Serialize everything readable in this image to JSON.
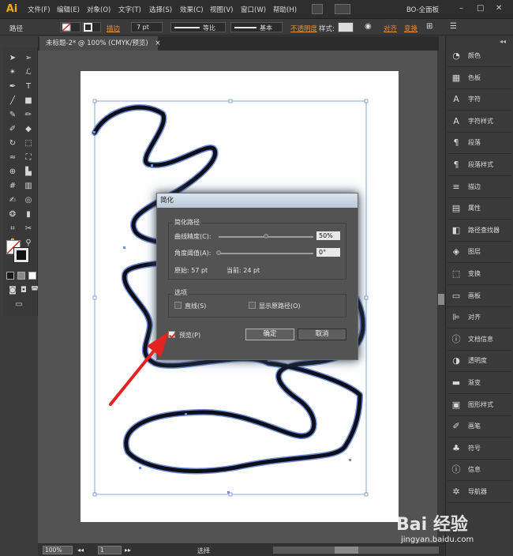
{
  "app": {
    "logo": "Ai",
    "menus": [
      "文件(F)",
      "编辑(E)",
      "对象(O)",
      "文字(T)",
      "选择(S)",
      "效果(C)",
      "视图(V)",
      "窗口(W)",
      "帮助(H)"
    ],
    "workspace": "BO-全面板",
    "window_controls": [
      "–",
      "□",
      "✕"
    ]
  },
  "control_bar": {
    "selection": "路径",
    "stroke_label": "描边",
    "stroke_weight": "7 pt",
    "profile_label": "等比",
    "brush_label": "基本",
    "opacity_label": "不透明度",
    "style_label": "样式:",
    "align_label": "对齐",
    "transform_label": "变换"
  },
  "document": {
    "tab_title": "未标题-2* @ 100% (CMYK/预览)",
    "tab_close": "×"
  },
  "status_bar": {
    "zoom": "100%",
    "page": "1",
    "tool": "选择"
  },
  "right_panel": {
    "items": [
      {
        "icon": "color-icon",
        "glyph": "◔",
        "label": "颜色"
      },
      {
        "icon": "swatches-icon",
        "glyph": "▦",
        "label": "色板"
      },
      {
        "icon": "character-icon",
        "glyph": "A",
        "label": "字符"
      },
      {
        "icon": "char-style-icon",
        "glyph": "A",
        "label": "字符样式"
      },
      {
        "icon": "paragraph-icon",
        "glyph": "¶",
        "label": "段落"
      },
      {
        "icon": "para-style-icon",
        "glyph": "¶",
        "label": "段落样式"
      },
      {
        "icon": "stroke-icon",
        "glyph": "≡",
        "label": "描边"
      },
      {
        "icon": "attributes-icon",
        "glyph": "▤",
        "label": "属性"
      },
      {
        "icon": "pathfinder-icon",
        "glyph": "◧",
        "label": "路径查找器"
      },
      {
        "icon": "layers-icon",
        "glyph": "◈",
        "label": "图层"
      },
      {
        "icon": "transform-icon",
        "glyph": "⬚",
        "label": "变换"
      },
      {
        "icon": "artboards-icon",
        "glyph": "▭",
        "label": "画板"
      },
      {
        "icon": "align-icon",
        "glyph": "⊫",
        "label": "对齐"
      },
      {
        "icon": "doc-info-icon",
        "glyph": "ⓘ",
        "label": "文档信息"
      },
      {
        "icon": "transparency-icon",
        "glyph": "◑",
        "label": "透明度"
      },
      {
        "icon": "gradient-icon",
        "glyph": "▬",
        "label": "渐变"
      },
      {
        "icon": "graphic-styles-icon",
        "glyph": "▣",
        "label": "图形样式"
      },
      {
        "icon": "brushes-icon",
        "glyph": "✐",
        "label": "画笔"
      },
      {
        "icon": "symbols-icon",
        "glyph": "♣",
        "label": "符号"
      },
      {
        "icon": "info-icon",
        "glyph": "ⓘ",
        "label": "信息"
      },
      {
        "icon": "navigator-icon",
        "glyph": "✲",
        "label": "导航器"
      }
    ]
  },
  "dialog": {
    "title": "简化",
    "simplify_group": "简化路径",
    "curve_precision_label": "曲线精度(C):",
    "curve_precision_value": "50%",
    "curve_precision_level": 0.5,
    "angle_threshold_label": "角度阈值(A):",
    "angle_threshold_value": "0°",
    "angle_threshold_level": 0.0,
    "original": "原始: 57 pt",
    "current": "当前: 24 pt",
    "options_group": "选项",
    "straight_lines": "直线(S)",
    "show_original": "显示原路径(O)",
    "preview": "预览(P)",
    "ok": "确定",
    "cancel": "取消"
  },
  "watermark": {
    "brand": "Bai  经验",
    "url": "jingyan.baidu.com"
  }
}
